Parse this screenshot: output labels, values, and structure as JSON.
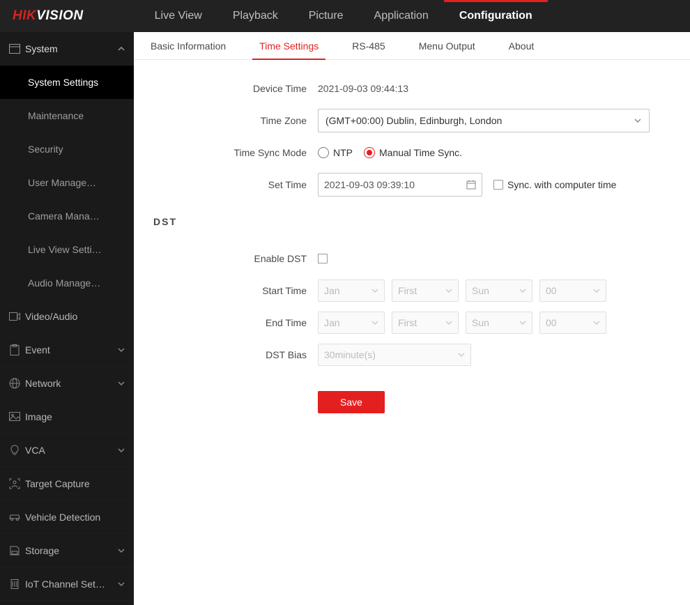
{
  "logo": {
    "part1": "HIK",
    "part2": "VISION"
  },
  "topnav": {
    "tabs": [
      "Live View",
      "Playback",
      "Picture",
      "Application",
      "Configuration"
    ],
    "active_index": 4
  },
  "sidebar": {
    "items": [
      {
        "label": "System",
        "expanded": true,
        "icon": "window-icon",
        "subs": [
          "System Settings",
          "Maintenance",
          "Security",
          "User Manage…",
          "Camera Mana…",
          "Live View Setti…",
          "Audio Manage…"
        ],
        "active_sub_index": 0
      },
      {
        "label": "Video/Audio",
        "icon": "video-icon"
      },
      {
        "label": "Event",
        "icon": "clipboard-icon",
        "chevron": true
      },
      {
        "label": "Network",
        "icon": "globe-icon",
        "chevron": true
      },
      {
        "label": "Image",
        "icon": "image-icon"
      },
      {
        "label": "VCA",
        "icon": "bulb-icon",
        "chevron": true
      },
      {
        "label": "Target Capture",
        "icon": "person-frame-icon"
      },
      {
        "label": "Vehicle Detection",
        "icon": "car-icon"
      },
      {
        "label": "Storage",
        "icon": "disk-icon",
        "chevron": true
      },
      {
        "label": "IoT Channel Set…",
        "icon": "iot-icon",
        "chevron": true
      }
    ]
  },
  "subtabs": {
    "tabs": [
      "Basic Information",
      "Time Settings",
      "RS-485",
      "Menu Output",
      "About"
    ],
    "active_index": 1
  },
  "form": {
    "device_time_label": "Device Time",
    "device_time_value": "2021-09-03 09:44:13",
    "time_zone_label": "Time Zone",
    "time_zone_value": "(GMT+00:00) Dublin, Edinburgh, London",
    "sync_mode_label": "Time Sync Mode",
    "sync_ntp": "NTP",
    "sync_manual": "Manual Time Sync.",
    "set_time_label": "Set Time",
    "set_time_value": "2021-09-03 09:39:10",
    "sync_pc_label": "Sync. with computer time",
    "dst_heading": "DST",
    "enable_dst_label": "Enable DST",
    "start_time_label": "Start Time",
    "end_time_label": "End Time",
    "dst_bias_label": "DST Bias",
    "month_ph": "Jan",
    "week_ph": "First",
    "day_ph": "Sun",
    "hour_ph": "00",
    "bias_ph": "30minute(s)",
    "save_label": "Save"
  }
}
